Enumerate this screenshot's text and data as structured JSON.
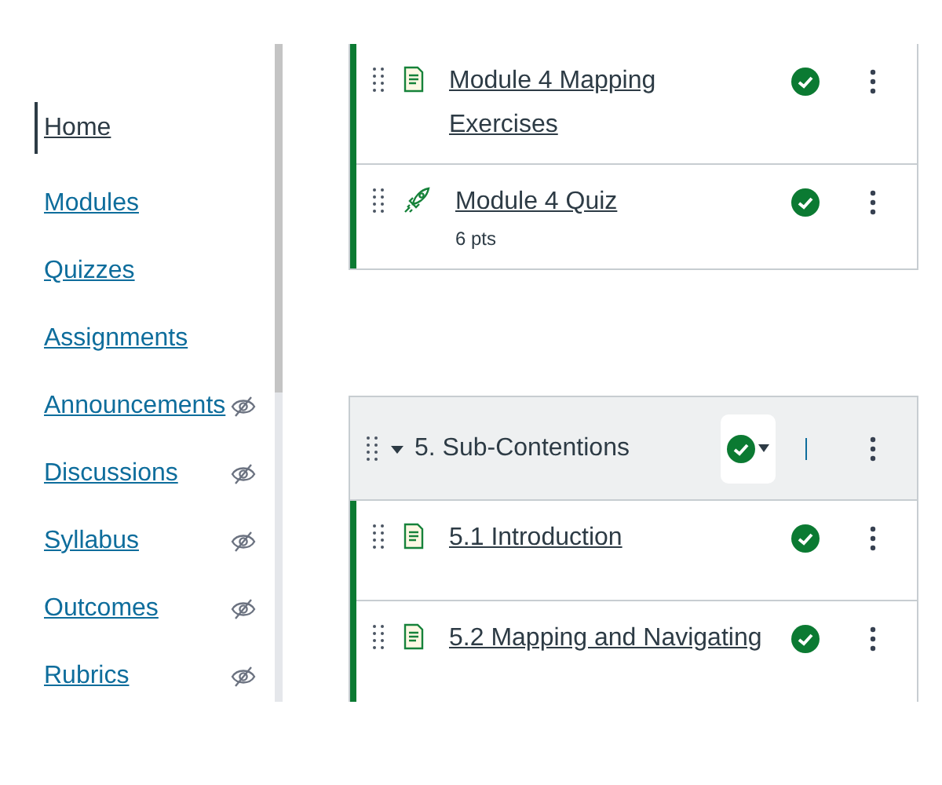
{
  "sidebar": {
    "items": [
      {
        "label": "Home",
        "selected": true,
        "hidden": false
      },
      {
        "label": "Modules",
        "selected": false,
        "hidden": false
      },
      {
        "label": "Quizzes",
        "selected": false,
        "hidden": false
      },
      {
        "label": "Assignments",
        "selected": false,
        "hidden": false
      },
      {
        "label": "Announcements",
        "selected": false,
        "hidden": true
      },
      {
        "label": "Discussions",
        "selected": false,
        "hidden": true
      },
      {
        "label": "Syllabus",
        "selected": false,
        "hidden": true
      },
      {
        "label": "Outcomes",
        "selected": false,
        "hidden": true
      },
      {
        "label": "Rubrics",
        "selected": false,
        "hidden": true
      }
    ]
  },
  "modules": [
    {
      "items": [
        {
          "kind": "page",
          "title": "Module 4 Mapping Exercises",
          "published": true
        },
        {
          "kind": "quiz",
          "title": "Module 4 Quiz",
          "points": "6 pts",
          "published": true
        }
      ]
    },
    {
      "title": "5. Sub-Contentions",
      "expanded": true,
      "published": true,
      "items": [
        {
          "kind": "page",
          "title": "5.1 Introduction",
          "published": true
        },
        {
          "kind": "page",
          "title": "5.2 Mapping and Navigating",
          "published": true
        }
      ]
    }
  ]
}
